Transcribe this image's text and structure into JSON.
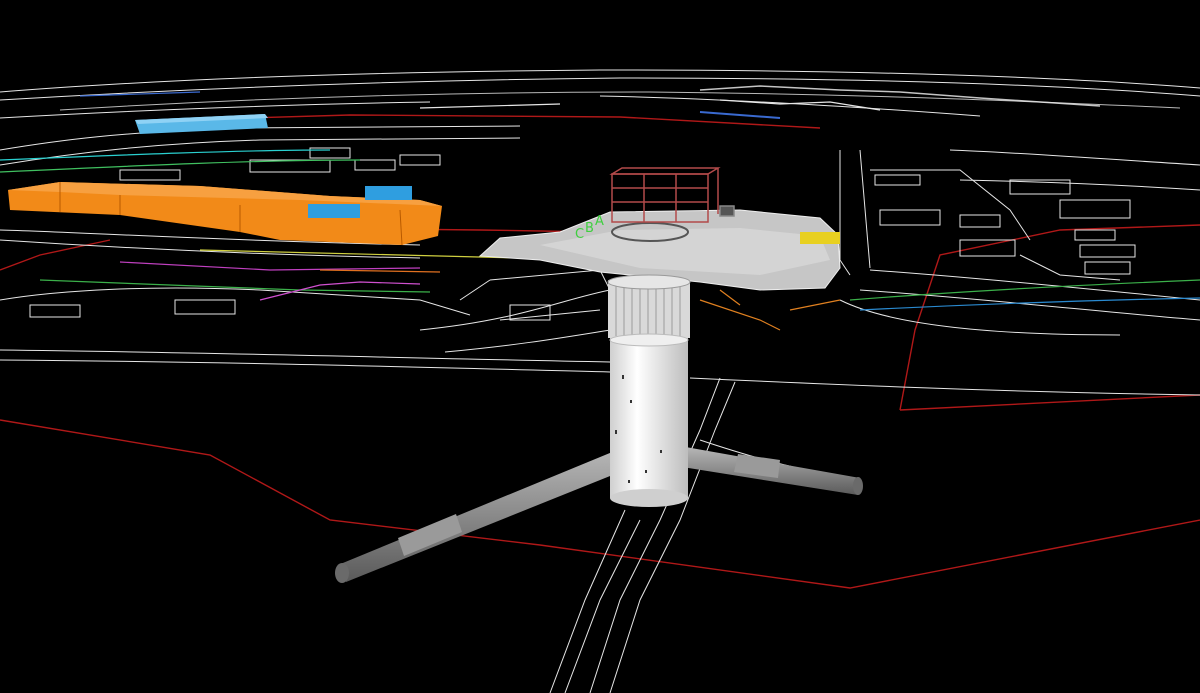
{
  "scene": {
    "background": "#000000",
    "colors": {
      "linework": "#e8e8e8",
      "boundary": "#b01818",
      "building_orange": "#f28a18",
      "building_blue": "#5ab8e8",
      "shaft": "#f2f2f2",
      "tunnel": "#8e8e8e",
      "deck": "#c8c8c8",
      "frame": "#b24a4a",
      "gridline_labels": "#3fcf3f"
    },
    "gridline_labels": [
      "C",
      "B",
      "A"
    ],
    "icons": [
      "site-linework",
      "orange-building",
      "blue-building",
      "station-box",
      "deck-slab",
      "shaft",
      "tunnel-east",
      "tunnel-west",
      "site-boundary"
    ]
  }
}
